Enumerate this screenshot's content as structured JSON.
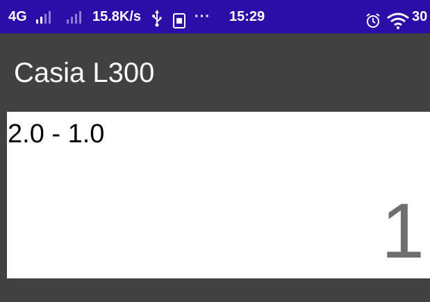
{
  "status_bar": {
    "network": "4G",
    "speed": "15.8K/s",
    "more": "···",
    "time": "15:29",
    "battery": "30",
    "icons": [
      "signal-icon",
      "signal-icon",
      "usb-icon",
      "debug-icon",
      "alarm-icon",
      "wifi-icon"
    ]
  },
  "app_bar": {
    "title": "Casia L300"
  },
  "card": {
    "range": "2.0 - 1.0",
    "value": "1"
  }
}
